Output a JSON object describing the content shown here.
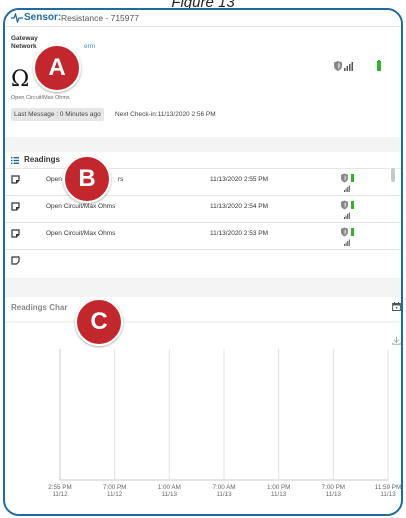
{
  "caption": "Figure 13",
  "header": {
    "sensor_label": "Sensor:",
    "sensor_name": "Resistance - 715977"
  },
  "overview": {
    "gateway_label": "Gateway",
    "network_label": "Network",
    "network_link": "erm",
    "reading_symbol": "Ω",
    "reading_text": "Open Circuit/Max Ohms",
    "last_message": "Last Message : 0 Minutes ago",
    "next_checkin": "Next Check-in:11/13/2020 2:56 PM"
  },
  "readings": {
    "title": "Readings",
    "rows": [
      {
        "value": "Open Circuit/Max Ohms",
        "value_visible": "Open C",
        "value_tail": "rs",
        "time": "11/13/2020 2:55 PM"
      },
      {
        "value": "Open Circuit/Max Ohms",
        "time": "11/13/2020 2:54 PM"
      },
      {
        "value": "Open Circuit/Max Ohms",
        "time": "11/13/2020 2:53 PM"
      }
    ]
  },
  "chart": {
    "title": "Readings Char",
    "x_ticks": [
      {
        "time": "2:55 PM",
        "date": "11/12"
      },
      {
        "time": "7:00 PM",
        "date": "11/12"
      },
      {
        "time": "1:00 AM",
        "date": "11/13"
      },
      {
        "time": "7:00 AM",
        "date": "11/13"
      },
      {
        "time": "1:00 PM",
        "date": "11/13"
      },
      {
        "time": "7:00 PM",
        "date": "11/13"
      },
      {
        "time": "11:59 PM",
        "date": "11/13"
      }
    ]
  },
  "chart_data": {
    "type": "line",
    "title": "",
    "xlabel": "",
    "ylabel": "",
    "x_tick_labels": [
      "2:55 PM 11/12",
      "7:00 PM 11/12",
      "1:00 AM 11/13",
      "7:00 AM 11/13",
      "1:00 PM 11/13",
      "7:00 PM 11/13",
      "11:59 PM 11/13"
    ],
    "series": [],
    "grid": "vertical"
  },
  "badges": {
    "a": "A",
    "b": "B",
    "c": "C"
  },
  "colors": {
    "accent": "#1e6aa3",
    "badge": "#c1272d",
    "battery": "#2db52d",
    "link": "#3b8fd6"
  }
}
